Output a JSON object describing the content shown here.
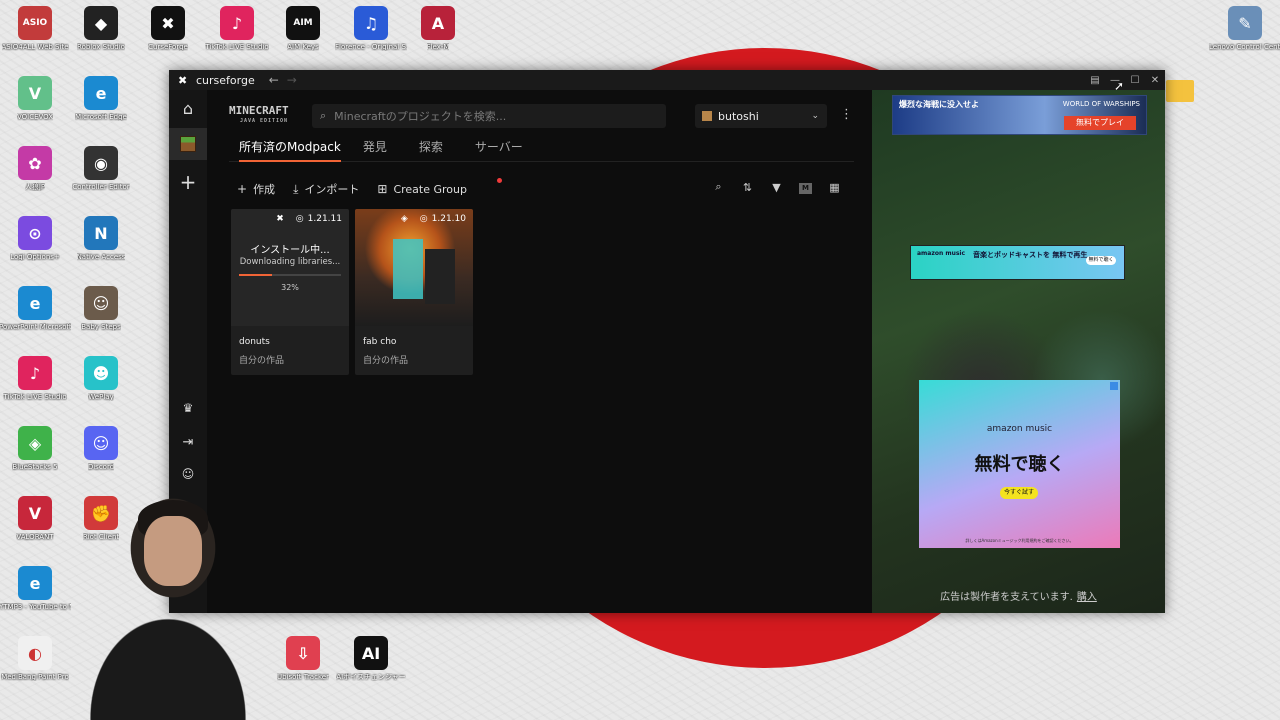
{
  "desktop": {
    "icons": [
      {
        "label": "ASIO4ALL Web Site",
        "color": "#c23b3b",
        "glyph": "ASIO"
      },
      {
        "label": "Roblox Studio",
        "color": "#222222",
        "glyph": "◆"
      },
      {
        "label": "CurseForge",
        "color": "#111111",
        "glyph": "✖"
      },
      {
        "label": "TikTok LIVE Studio",
        "color": "#e0245e",
        "glyph": "♪"
      },
      {
        "label": "AIM Keys",
        "color": "#111111",
        "glyph": "AIM"
      },
      {
        "label": "Florence - Original S...",
        "color": "#2a5bd7",
        "glyph": "♫"
      },
      {
        "label": "Flex-M",
        "color": "#b8223a",
        "glyph": "A"
      },
      {
        "label": "VOICEVOX",
        "color": "#62c08a",
        "glyph": "V"
      },
      {
        "label": "Microsoft Edge",
        "color": "#1b8ad1",
        "glyph": "e"
      },
      {
        "label": "人狼JP",
        "color": "#c43aa6",
        "glyph": "✿"
      },
      {
        "label": "Controller Editor",
        "color": "#333333",
        "glyph": "◉"
      },
      {
        "label": "Logi Options+",
        "color": "#7b4be0",
        "glyph": "⊙"
      },
      {
        "label": "Native Access",
        "color": "#2277bb",
        "glyph": "N"
      },
      {
        "label": "PowerPoint Microsoft 365",
        "color": "#1b8ad1",
        "glyph": "e"
      },
      {
        "label": "Baby Steps",
        "color": "#6b5b4b",
        "glyph": "☺"
      },
      {
        "label": "TikTok LIVE Studio",
        "color": "#e0245e",
        "glyph": "♪"
      },
      {
        "label": "WePlay",
        "color": "#27c2c9",
        "glyph": "☻"
      },
      {
        "label": "BlueStacks 5",
        "color": "#3fb24a",
        "glyph": "◈"
      },
      {
        "label": "Discord",
        "color": "#5865f2",
        "glyph": "☺"
      },
      {
        "label": "VALORANT",
        "color": "#c7273b",
        "glyph": "V"
      },
      {
        "label": "Riot Client",
        "color": "#d13a3a",
        "glyph": "✊"
      },
      {
        "label": "YTMP3 - YouTube to MP3 Converter",
        "color": "#1b8ad1",
        "glyph": "e"
      },
      {
        "label": "MediBang Paint Pro",
        "color": "#f0f0f0",
        "glyph": "◐"
      },
      {
        "label": "Ubisoft Tracker",
        "color": "#e04050",
        "glyph": "⇩"
      },
      {
        "label": "AIボイスチェンジャー",
        "color": "#111111",
        "glyph": "AI"
      },
      {
        "label": "Lenovo Control Center",
        "color": "#6a8fb8",
        "glyph": "✎"
      }
    ]
  },
  "window": {
    "app_name": "curseforge",
    "back_icon": "arrow-left-icon",
    "forward_icon": "arrow-right-icon"
  },
  "sidebar": {
    "items": [
      {
        "name": "home",
        "icon": "home-icon"
      },
      {
        "name": "minecraft",
        "icon": "grass-block-icon"
      },
      {
        "name": "add-game",
        "icon": "plus-icon"
      },
      {
        "name": "premium",
        "icon": "crown-icon"
      },
      {
        "name": "login",
        "icon": "login-icon"
      },
      {
        "name": "discord",
        "icon": "discord-icon"
      }
    ]
  },
  "header": {
    "game_logo": "MINECRAFT",
    "game_edition": "JAVA EDITION",
    "search_placeholder": "Minecraftのプロジェクトを検索...",
    "profile_name": "butoshi"
  },
  "tabs": [
    {
      "label": "所有済のModpack",
      "active": true
    },
    {
      "label": "発見",
      "active": false
    },
    {
      "label": "探索",
      "active": false
    },
    {
      "label": "サーバー",
      "active": false
    }
  ],
  "toolbar": {
    "create_label": "作成",
    "import_label": "インポート",
    "group_label": "Create Group"
  },
  "cards": [
    {
      "name": "donuts",
      "owner": "自分の作品",
      "version": "1.21.11",
      "installing": true,
      "install_title": "インストール中...",
      "install_status": "Downloading libraries...",
      "progress_text": "32%",
      "progress": 0.32
    },
    {
      "name": "fab cho",
      "owner": "自分の作品",
      "version": "1.21.10",
      "installing": false
    }
  ],
  "ads": {
    "top_banner_text": "爆烈な海戦に没入せよ",
    "top_banner_brand": "WORLD OF WARSHIPS",
    "top_banner_button": "無料でプレイ",
    "mid_banner_brand": "amazon music",
    "mid_banner_text": "音楽とポッドキャストを 無料で再生",
    "mid_banner_button": "無料で聴く",
    "box_brand": "amazon music",
    "box_headline": "無料で聴く",
    "box_button": "今すぐ試す",
    "box_fine": "詳しくはAmazonミュージック利用規約をご確認ください。",
    "support_note": "広告は製作者を支えています.",
    "support_link": "購入"
  }
}
